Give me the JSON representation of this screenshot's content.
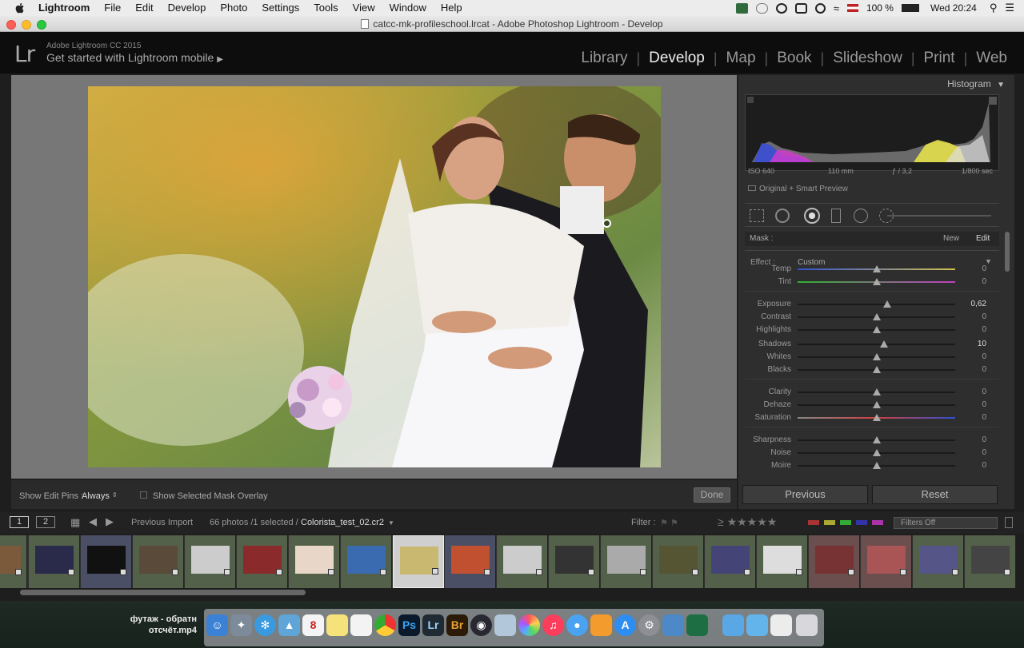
{
  "menubar": {
    "app": "Lightroom",
    "items": [
      "File",
      "Edit",
      "Develop",
      "Photo",
      "Settings",
      "Tools",
      "View",
      "Window",
      "Help"
    ],
    "battery": "100 %",
    "clock": "Wed 20:24"
  },
  "window": {
    "title": "catcc-mk-profileschool.lrcat - Adobe Photoshop Lightroom - Develop"
  },
  "header": {
    "logo": "Lr",
    "version": "Adobe Lightroom CC 2015",
    "mobile": "Get started with Lightroom mobile",
    "modules": [
      "Library",
      "Develop",
      "Map",
      "Book",
      "Slideshow",
      "Print",
      "Web"
    ],
    "active_module": "Develop"
  },
  "toolbar": {
    "edit_pins_label": "Show Edit Pins :",
    "edit_pins_value": "Always",
    "mask_overlay_label": "Show Selected Mask Overlay",
    "done": "Done"
  },
  "histogram": {
    "title": "Histogram",
    "iso": "ISO 640",
    "focal": "110 mm",
    "aperture": "ƒ / 3,2",
    "shutter": "1/800 sec",
    "preview": "Original + Smart Preview"
  },
  "mask": {
    "label": "Mask :",
    "new": "New",
    "edit": "Edit"
  },
  "effect": {
    "label": "Effect :",
    "preset": "Custom"
  },
  "adjustments": [
    {
      "name": "Temp",
      "value": "0",
      "pos": 0.5,
      "track": "temp"
    },
    {
      "name": "Tint",
      "value": "0",
      "pos": 0.5,
      "track": "tint"
    },
    {
      "name": "Exposure",
      "value": "0,62",
      "pos": 0.57,
      "track": "plain"
    },
    {
      "name": "Contrast",
      "value": "0",
      "pos": 0.5,
      "track": "plain"
    },
    {
      "name": "Highlights",
      "value": "0",
      "pos": 0.5,
      "track": "plain"
    },
    {
      "name": "Shadows",
      "value": "10",
      "pos": 0.55,
      "track": "plain"
    },
    {
      "name": "Whites",
      "value": "0",
      "pos": 0.5,
      "track": "plain"
    },
    {
      "name": "Blacks",
      "value": "0",
      "pos": 0.5,
      "track": "plain"
    },
    {
      "name": "Clarity",
      "value": "0",
      "pos": 0.5,
      "track": "plain"
    },
    {
      "name": "Dehaze",
      "value": "0",
      "pos": 0.5,
      "track": "plain"
    },
    {
      "name": "Saturation",
      "value": "0",
      "pos": 0.5,
      "track": "sat"
    },
    {
      "name": "Sharpness",
      "value": "0",
      "pos": 0.5,
      "track": "plain"
    },
    {
      "name": "Noise",
      "value": "0",
      "pos": 0.5,
      "track": "plain"
    },
    {
      "name": "Moire",
      "value": "0",
      "pos": 0.5,
      "track": "plain"
    }
  ],
  "panel_buttons": {
    "previous": "Previous",
    "reset": "Reset"
  },
  "filmbar": {
    "view1": "1",
    "view2": "2",
    "source": "Previous Import",
    "count": "66 photos /1 selected /",
    "filename": "Colorista_test_02.cr2",
    "filter_label": "Filter :",
    "filter_value": "Filters Off"
  },
  "dock": {
    "label_line1": "футаж - обратн",
    "label_line2": "отсчёт.mp4"
  },
  "colors": {
    "accent_active_module": "#eeeeee",
    "panel_bg": "#2e2e2e",
    "work_bg": "#777777"
  }
}
